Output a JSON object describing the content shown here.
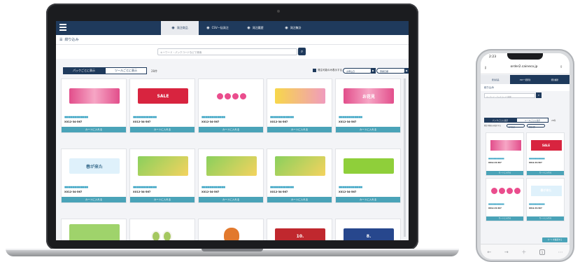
{
  "laptop": {
    "tabs": [
      {
        "label": "発注商品",
        "icon": "order-icon",
        "active": true
      },
      {
        "label": "CSV一括発注",
        "icon": "csv-icon",
        "active": false
      },
      {
        "label": "発注履歴",
        "icon": "history-icon",
        "active": false
      },
      {
        "label": "発注集計",
        "icon": "stats-icon",
        "active": false
      }
    ],
    "filter_label": "絞り込み",
    "search_placeholder": "キーワード・パックコードなどで検索",
    "view_tabs": [
      "パックごとに表示",
      "ツールごとに表示"
    ],
    "count_text": "28件",
    "checkbox_label": "発注可能のみ表示する",
    "sort_selects": [
      "お申込日",
      "登録日順"
    ],
    "cards": [
      {
        "dots": "■■■■■■■■■■■■",
        "code": "XX12-34-567",
        "cart": "カートに入れる",
        "art": "pink-banner",
        "art_text": ""
      },
      {
        "dots": "■■■■■■■■■■■■",
        "code": "XX12-34-567",
        "cart": "カートに入れる",
        "art": "sale-banner",
        "art_text": "SALE"
      },
      {
        "dots": "■■■■■■■■■■■■",
        "code": "XX12-34-567",
        "cart": "カートに入れる",
        "art": "fan",
        "art_text": ""
      },
      {
        "dots": "■■■■■■■■■■■■",
        "code": "XX12-34-567",
        "cart": "カートに入れる",
        "art": "yellow-banner",
        "art_text": ""
      },
      {
        "dots": "■■■■■■■■■■■■",
        "code": "XX12-34-567",
        "cart": "カートに入れる",
        "art": "pink-banner2",
        "art_text": "お花見"
      },
      {
        "dots": "■■■■■■■■■■■■",
        "code": "XX12-34-567",
        "cart": "カートに入れる",
        "art": "spring-banner",
        "art_text": "春が来た"
      },
      {
        "dots": "■■■■■■■■■■■■",
        "code": "XX12-34-567",
        "cart": "カートに入れる",
        "art": "photo-banner",
        "art_text": ""
      },
      {
        "dots": "■■■■■■■■■■■■",
        "code": "XX12-34-567",
        "cart": "カートに入れる",
        "art": "photo-banner2",
        "art_text": ""
      },
      {
        "dots": "■■■■■■■■■■■■",
        "code": "XX12-34-567",
        "cart": "カートに入れる",
        "art": "photo-banner3",
        "art_text": ""
      },
      {
        "dots": "■■■■■■■■■■■■",
        "code": "XX12-34-567",
        "cart": "カートに入れる",
        "art": "green-banner",
        "art_text": ""
      },
      {
        "dots": "■■■■■■■■■■■■",
        "code": "",
        "cart": "",
        "art": "food-banner",
        "art_text": ""
      },
      {
        "dots": "■■■■■■■■■■■■",
        "code": "",
        "cart": "",
        "art": "ovals",
        "art_text": ""
      },
      {
        "dots": "■■■■■■■■■■■■",
        "code": "",
        "cart": "",
        "art": "pumpkin",
        "art_text": ""
      },
      {
        "dots": "■■■■■■■■■■■■",
        "code": "",
        "cart": "",
        "art": "red-banner",
        "art_text": "10."
      },
      {
        "dots": "■■■■■■■■■■■■",
        "code": "",
        "cart": "",
        "art": "navy-banner",
        "art_text": "8."
      }
    ]
  },
  "phone": {
    "time": "2:23",
    "url": "order2.caineco.jp",
    "tabs": [
      "発注商品",
      "CSV一括発注",
      "発注履歴"
    ],
    "filter_label": "絞り込み",
    "search_placeholder": "キーワード・パックコードで検索",
    "view_tabs": [
      "パックごとに表示",
      "ツールごとに表示"
    ],
    "count_text": "28件",
    "checkbox_label": "発注可能のみ表示する",
    "sort_selects": [
      "お申込日",
      "登録日順"
    ],
    "cards": [
      {
        "dots": "■■■■■■■■■■■■",
        "code": "XX12-34-567",
        "cart": "カートに入れる",
        "art": "pink-banner",
        "art_text": ""
      },
      {
        "dots": "■■■■■■■■■■■■",
        "code": "XX12-34-567",
        "cart": "カートに入れる",
        "art": "sale-banner",
        "art_text": "SALE"
      },
      {
        "dots": "■■■■■■■■■■■■",
        "code": "XX12-34-567",
        "cart": "カートに入れる",
        "art": "fan",
        "art_text": ""
      },
      {
        "dots": "■■■■■■■■■■■■",
        "code": "XX12-34-567",
        "cart": "カートに入れる",
        "art": "spring-banner",
        "art_text": "春が来た"
      }
    ],
    "floating_button": "カートを確認する",
    "bottom_bar": [
      "back-icon",
      "forward-icon",
      "add-tab-icon",
      "tabs-icon",
      "more-icon"
    ]
  }
}
